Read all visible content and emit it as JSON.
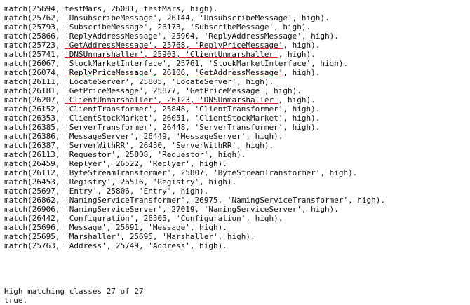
{
  "console": {
    "lines": [
      {
        "text": "match(25694, testMars, 26081, testMars, high).",
        "highlight": false
      },
      {
        "text": "match(25762, 'UnsubscribeMessage', 26144, 'UnsubscribeMessage', high).",
        "highlight": false
      },
      {
        "text": "match(25793, 'SubscribeMessage', 26173, 'SubscribeMessage', high).",
        "highlight": false
      },
      {
        "text": "match(25866, 'ReplyAddressMessage', 25904, 'ReplyAddressMessage', high).",
        "highlight": false
      },
      {
        "text": "match(25723, 'GetAddressMessage', 25768, 'ReplyPriceMessage', high).",
        "highlight": true
      },
      {
        "text": "match(25741, 'DNSUnmarshaller', 25903, 'ClientUnmarshaller', high).",
        "highlight": true
      },
      {
        "text": "match(26067, 'StockMarketInterface', 25761, 'StockMarketInterface', high).",
        "highlight": false
      },
      {
        "text": "match(26074, 'ReplyPriceMessage', 26106, 'GetAddressMessage', high).",
        "highlight": true
      },
      {
        "text": "match(26111, 'LocateServer', 25805, 'LocateServer', high).",
        "highlight": false
      },
      {
        "text": "match(26181, 'GetPriceMessage', 25877, 'GetPriceMessage', high).",
        "highlight": false
      },
      {
        "text": "match(26207, 'ClientUnmarshaller', 26123, 'DNSUnmarshaller', high).",
        "highlight": true
      },
      {
        "text": "match(26152, 'ClientTransformer', 25848, 'ClientTransformer', high).",
        "highlight": false
      },
      {
        "text": "match(26353, 'ClientStockMarket', 26051, 'ClientStockMarket', high).",
        "highlight": false
      },
      {
        "text": "match(26385, 'ServerTransformer', 26448, 'ServerTransformer', high).",
        "highlight": false
      },
      {
        "text": "match(26386, 'MessageServer', 26449, 'MessageServer', high).",
        "highlight": false
      },
      {
        "text": "match(26387, 'ServerWithRR', 26450, 'ServerWithRR', high).",
        "highlight": false
      },
      {
        "text": "match(26113, 'Requestor', 25808, 'Requestor', high).",
        "highlight": false
      },
      {
        "text": "match(26459, 'Replyer', 26522, 'Replyer', high).",
        "highlight": false
      },
      {
        "text": "match(26112, 'ByteStreamTransformer', 25807, 'ByteStreamTransformer', high).",
        "highlight": false
      },
      {
        "text": "match(26453, 'Registry', 26516, 'Registry', high).",
        "highlight": false
      },
      {
        "text": "match(25697, 'Entry', 25806, 'Entry', high).",
        "highlight": false
      },
      {
        "text": "match(26862, 'NamingServiceTransformer', 26975, 'NamingServiceTransformer', high).",
        "highlight": false
      },
      {
        "text": "match(26906, 'NamingServiceServer', 27019, 'NamingServiceServer', high).",
        "highlight": false
      },
      {
        "text": "match(26442, 'Configuration', 26505, 'Configuration', high).",
        "highlight": false
      },
      {
        "text": "match(25696, 'Message', 25691, 'Message', high).",
        "highlight": false
      },
      {
        "text": "match(25695, 'Marshaller', 25695, 'Marshaller', high).",
        "highlight": false
      },
      {
        "text": "match(25763, 'Address', 25749, 'Address', high).",
        "highlight": false
      }
    ],
    "summary": "High matching classes 27 of 27",
    "result": "true."
  },
  "colors": {
    "background": "#ffffff",
    "text": "#111111",
    "highlight_underline": "#dd2222"
  }
}
